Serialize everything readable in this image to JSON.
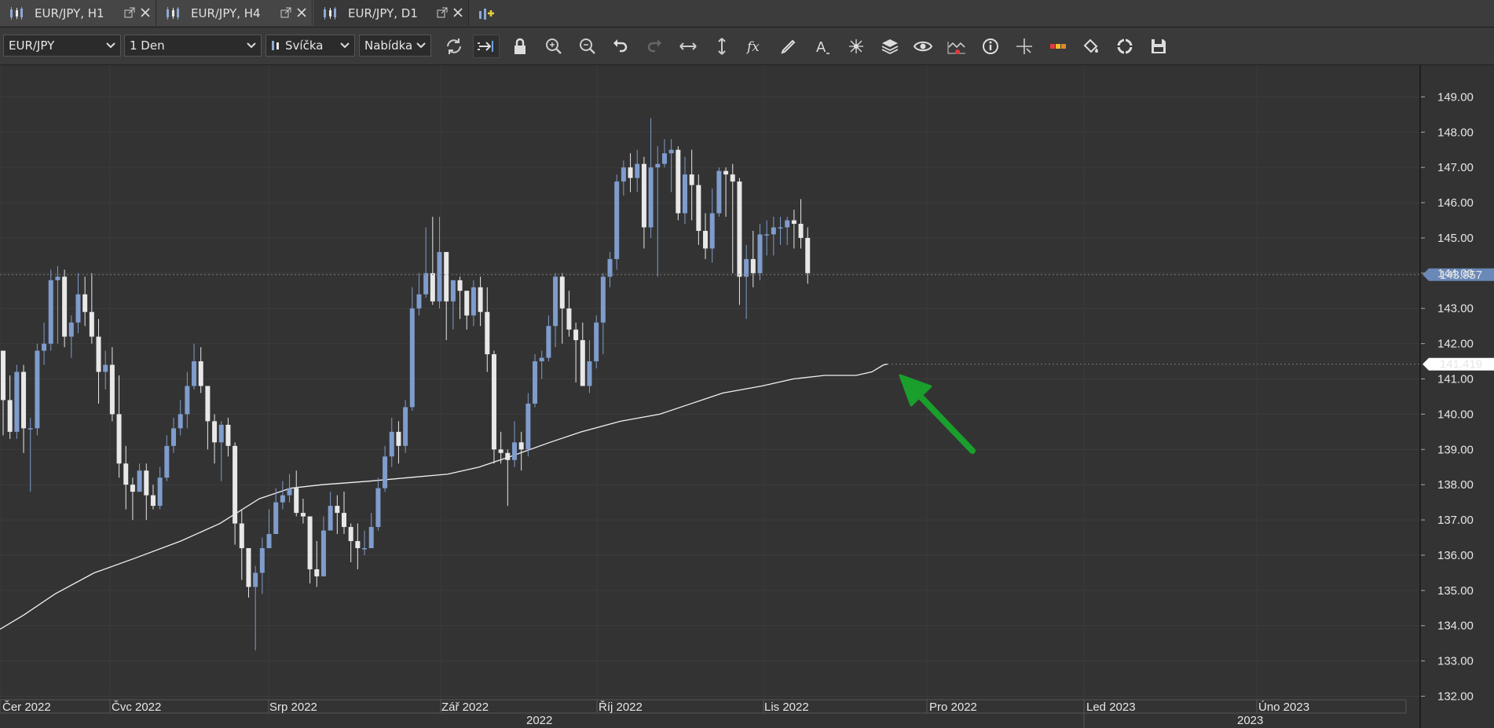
{
  "tabs": [
    {
      "label": "EUR/JPY, H1",
      "active": false
    },
    {
      "label": "EUR/JPY, H4",
      "active": false
    },
    {
      "label": "EUR/JPY, D1",
      "active": true
    }
  ],
  "toolbar": {
    "instrument": "EUR/JPY",
    "period": "1 Den",
    "chart_type": "Svíčka",
    "price_side": "Nabídka",
    "buttons": [
      "refresh-icon",
      "auto-shift-icon",
      "lock-icon",
      "zoom-in-icon",
      "zoom-out-icon",
      "undo-icon",
      "redo-icon",
      "horizontal-scale-icon",
      "vertical-scale-icon",
      "indicators-fx-icon",
      "pencil-icon",
      "text-tool-icon",
      "pattern-tool-icon",
      "layers-icon",
      "eye-icon",
      "signals-icon",
      "info-icon",
      "crosshair-icon",
      "theme-icon",
      "paint-bucket-icon",
      "compass-icon",
      "save-icon"
    ]
  },
  "colors": {
    "background": "#333333",
    "bull_candle": "#7f9ccc",
    "bear_candle": "#e8e8e8",
    "ma_line": "#f2f2f2",
    "arrow": "#1a9e2c",
    "current_price_tag": "#6a88b8"
  },
  "chart_data": {
    "type": "candlestick",
    "instrument": "EUR/JPY",
    "timeframe": "1 Den",
    "y_ticks": [
      "149.00",
      "148.00",
      "147.00",
      "146.00",
      "145.00",
      "144.00",
      "143.00",
      "142.00",
      "141.00",
      "140.00",
      "139.00",
      "138.00",
      "137.00",
      "136.00",
      "135.00",
      "134.00",
      "133.00",
      "132.00"
    ],
    "ylim": [
      131.9,
      149.9
    ],
    "x_labels": [
      "Čer 2022",
      "Čvc 2022",
      "Srp 2022",
      "Zář 2022",
      "Říj 2022",
      "Lis 2022",
      "Pro 2022",
      "Led 2023",
      "Úno 2023"
    ],
    "year_labels": [
      "2022",
      "2023"
    ],
    "current_price": "143.957",
    "ma_value": "141.419",
    "candles": [
      [
        141.8,
        140.4,
        141.8,
        139.4
      ],
      [
        140.4,
        139.5,
        141.1,
        139.3
      ],
      [
        139.5,
        141.2,
        141.4,
        139.3
      ],
      [
        141.2,
        139.6,
        141.4,
        138.9
      ],
      [
        139.6,
        139.6,
        139.9,
        137.8
      ],
      [
        139.6,
        141.8,
        142.0,
        139.4
      ],
      [
        141.8,
        142.0,
        142.6,
        141.4
      ],
      [
        142.0,
        143.8,
        144.1,
        141.8
      ],
      [
        143.8,
        143.9,
        144.2,
        142.0
      ],
      [
        143.9,
        142.2,
        144.1,
        141.9
      ],
      [
        142.2,
        142.6,
        142.8,
        141.6
      ],
      [
        142.6,
        143.4,
        144.0,
        142.3
      ],
      [
        143.4,
        142.9,
        143.9,
        142.5
      ],
      [
        142.9,
        142.2,
        144.0,
        142.0
      ],
      [
        142.2,
        141.2,
        142.7,
        140.3
      ],
      [
        141.2,
        141.4,
        141.8,
        140.7
      ],
      [
        141.4,
        140.0,
        141.9,
        139.8
      ],
      [
        140.0,
        138.6,
        141.1,
        138.2
      ],
      [
        138.6,
        138.0,
        139.1,
        137.3
      ],
      [
        138.0,
        137.8,
        138.2,
        137.0
      ],
      [
        137.8,
        138.4,
        138.6,
        137.8
      ],
      [
        138.4,
        137.7,
        138.6,
        137.0
      ],
      [
        137.7,
        137.4,
        138.0,
        137.3
      ],
      [
        137.4,
        138.2,
        138.5,
        137.3
      ],
      [
        138.2,
        139.1,
        139.4,
        138.1
      ],
      [
        139.1,
        139.6,
        139.9,
        138.9
      ],
      [
        139.6,
        140.0,
        140.4,
        139.4
      ],
      [
        140.0,
        140.8,
        141.2,
        139.6
      ],
      [
        140.8,
        141.5,
        142.0,
        140.7
      ],
      [
        141.5,
        140.8,
        141.9,
        140.6
      ],
      [
        140.8,
        139.8,
        140.6,
        139.0
      ],
      [
        139.8,
        139.2,
        140.0,
        138.6
      ],
      [
        139.2,
        139.7,
        139.8,
        138.1
      ],
      [
        139.7,
        139.1,
        139.9,
        138.8
      ],
      [
        139.1,
        136.9,
        139.2,
        136.3
      ],
      [
        136.9,
        136.2,
        137.3,
        135.3
      ],
      [
        136.2,
        135.1,
        136.1,
        134.8
      ],
      [
        135.1,
        135.5,
        135.7,
        133.3
      ],
      [
        135.5,
        136.2,
        136.5,
        134.9
      ],
      [
        136.2,
        136.6,
        137.3,
        136.2
      ],
      [
        136.6,
        137.5,
        137.9,
        137.1
      ],
      [
        137.5,
        137.7,
        138.1,
        137.3
      ],
      [
        137.7,
        137.9,
        138.3,
        137.5
      ],
      [
        137.9,
        137.2,
        138.4,
        137.1
      ],
      [
        137.2,
        137.1,
        137.6,
        136.9
      ],
      [
        137.1,
        135.6,
        137.1,
        135.2
      ],
      [
        135.6,
        135.4,
        136.4,
        135.1
      ],
      [
        135.4,
        136.7,
        137.1,
        136.0
      ],
      [
        136.7,
        137.4,
        137.8,
        136.7
      ],
      [
        137.4,
        137.2,
        137.7,
        136.6
      ],
      [
        137.2,
        136.8,
        137.8,
        136.6
      ],
      [
        136.8,
        136.4,
        136.9,
        135.8
      ],
      [
        136.4,
        136.2,
        136.9,
        135.6
      ],
      [
        136.2,
        136.2,
        136.7,
        136.0
      ],
      [
        136.2,
        136.8,
        137.2,
        136.4
      ],
      [
        136.8,
        137.9,
        138.2,
        136.7
      ],
      [
        137.9,
        138.8,
        139.1,
        137.8
      ],
      [
        138.8,
        139.5,
        139.9,
        138.5
      ],
      [
        139.5,
        139.1,
        139.8,
        138.6
      ],
      [
        139.1,
        140.2,
        140.4,
        138.9
      ],
      [
        140.2,
        143.0,
        143.6,
        140.1
      ],
      [
        143.0,
        143.4,
        144.0,
        142.8
      ],
      [
        143.4,
        144.0,
        145.3,
        143.3
      ],
      [
        144.0,
        143.2,
        145.6,
        143.1
      ],
      [
        143.2,
        144.6,
        145.6,
        143.0
      ],
      [
        144.6,
        143.2,
        144.5,
        142.1
      ],
      [
        143.2,
        143.8,
        143.7,
        142.4
      ],
      [
        143.8,
        143.5,
        143.9,
        142.7
      ],
      [
        143.5,
        142.8,
        143.5,
        142.4
      ],
      [
        142.8,
        143.6,
        143.8,
        142.5
      ],
      [
        143.6,
        142.9,
        143.9,
        142.5
      ],
      [
        142.9,
        141.7,
        143.6,
        141.2
      ],
      [
        141.7,
        139.0,
        141.8,
        138.6
      ],
      [
        139.0,
        138.9,
        139.5,
        138.6
      ],
      [
        138.9,
        138.7,
        139.0,
        137.4
      ],
      [
        138.7,
        139.2,
        139.8,
        138.5
      ],
      [
        139.2,
        139.0,
        139.5,
        138.4
      ],
      [
        139.0,
        140.3,
        140.6,
        138.8
      ],
      [
        140.3,
        141.5,
        141.7,
        140.2
      ],
      [
        141.5,
        141.6,
        141.8,
        141.0
      ],
      [
        141.6,
        142.5,
        142.8,
        141.5
      ],
      [
        142.5,
        143.9,
        144.0,
        141.9
      ],
      [
        143.9,
        143.0,
        144.0,
        142.0
      ],
      [
        143.0,
        142.4,
        143.5,
        142.2
      ],
      [
        142.4,
        142.1,
        142.6,
        140.9
      ],
      [
        142.1,
        140.8,
        142.6,
        140.8
      ],
      [
        140.8,
        141.5,
        142.1,
        140.6
      ],
      [
        141.5,
        142.6,
        142.8,
        141.3
      ],
      [
        142.6,
        143.9,
        144.0,
        141.7
      ],
      [
        143.9,
        144.4,
        144.6,
        143.6
      ],
      [
        144.4,
        146.6,
        146.8,
        144.1
      ],
      [
        146.6,
        147.0,
        147.2,
        146.2
      ],
      [
        147.0,
        146.7,
        147.4,
        146.3
      ],
      [
        146.7,
        147.1,
        147.5,
        146.3
      ],
      [
        147.1,
        145.3,
        147.3,
        144.7
      ],
      [
        145.3,
        147.0,
        148.4,
        145.0
      ],
      [
        147.0,
        147.1,
        147.6,
        143.9
      ],
      [
        147.1,
        147.4,
        147.8,
        147.0
      ],
      [
        147.4,
        147.5,
        147.8,
        146.3
      ],
      [
        147.5,
        145.7,
        147.6,
        145.5
      ],
      [
        145.7,
        146.8,
        147.3,
        145.4
      ],
      [
        146.8,
        146.5,
        147.5,
        145.5
      ],
      [
        146.5,
        145.2,
        146.8,
        144.8
      ],
      [
        145.2,
        144.7,
        145.7,
        144.4
      ],
      [
        144.7,
        145.7,
        146.4,
        144.3
      ],
      [
        145.7,
        146.9,
        147.0,
        145.6
      ],
      [
        146.9,
        146.8,
        147.0,
        145.6
      ],
      [
        146.8,
        146.6,
        147.1,
        144.0
      ],
      [
        146.6,
        143.9,
        146.7,
        143.1
      ],
      [
        143.9,
        144.4,
        144.8,
        142.7
      ],
      [
        144.4,
        144.0,
        145.2,
        143.6
      ],
      [
        144.0,
        145.1,
        145.4,
        143.8
      ],
      [
        145.1,
        145.1,
        145.5,
        144.5
      ],
      [
        145.1,
        145.3,
        145.6,
        144.5
      ],
      [
        145.3,
        145.3,
        145.6,
        144.8
      ],
      [
        145.3,
        145.5,
        145.6,
        144.8
      ],
      [
        145.5,
        145.4,
        145.8,
        144.7
      ],
      [
        145.4,
        145.0,
        146.1,
        144.7
      ],
      [
        145.0,
        144.0,
        145.3,
        143.7
      ]
    ],
    "ma": [
      [
        0,
        133.9
      ],
      [
        30,
        134.3
      ],
      [
        70,
        134.9
      ],
      [
        120,
        135.5
      ],
      [
        170,
        135.9
      ],
      [
        230,
        136.4
      ],
      [
        280,
        136.9
      ],
      [
        330,
        137.6
      ],
      [
        370,
        137.9
      ],
      [
        410,
        138.0
      ],
      [
        470,
        138.1
      ],
      [
        520,
        138.2
      ],
      [
        570,
        138.3
      ],
      [
        610,
        138.5
      ],
      [
        650,
        138.8
      ],
      [
        700,
        139.2
      ],
      [
        740,
        139.5
      ],
      [
        790,
        139.8
      ],
      [
        840,
        140.0
      ],
      [
        880,
        140.3
      ],
      [
        920,
        140.6
      ],
      [
        970,
        140.8
      ],
      [
        1010,
        141.0
      ],
      [
        1050,
        141.1
      ],
      [
        1090,
        141.1
      ],
      [
        1110,
        141.2
      ],
      [
        1125,
        141.4
      ],
      [
        1130,
        141.42
      ]
    ]
  }
}
